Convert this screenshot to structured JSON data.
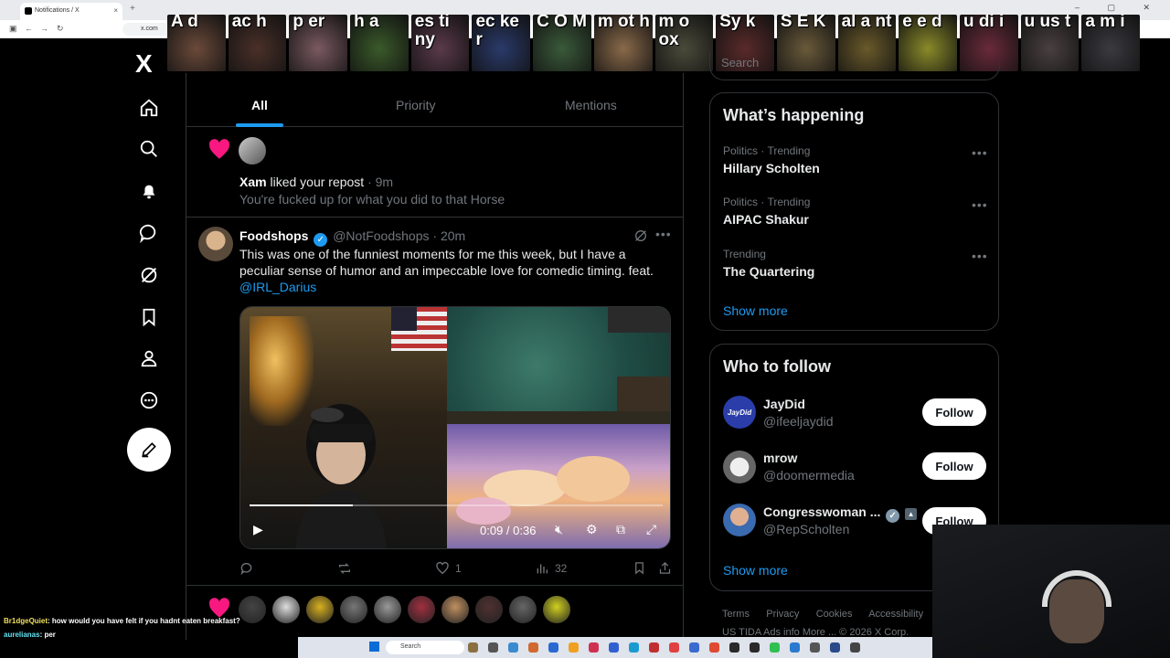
{
  "browser": {
    "tab_title": "Notifications / X",
    "tab_close": "×",
    "new_tab": "+",
    "window_controls": "– ▢ ✕",
    "address": "x.com"
  },
  "stream_overlay": {
    "emote_labels": [
      "A d",
      "ac h",
      "p er",
      "h a",
      "es ti ny",
      "ec ke r",
      "C O M",
      "m ot h",
      "m o ox",
      "Sy k",
      "S E K",
      "al a nt",
      "e e d",
      "u di i",
      "u us t",
      "a m i"
    ]
  },
  "nav": {
    "logo": "X",
    "items": [
      "home",
      "explore",
      "notifications",
      "messages",
      "grok",
      "bookmarks",
      "profile",
      "more"
    ]
  },
  "notifications": {
    "tabs": [
      "All",
      "Priority",
      "Mentions"
    ],
    "active_tab": "All",
    "liked": {
      "user": "Xam",
      "action": "liked your repost",
      "time": "· 9m",
      "text": "You're fucked up for what you did to that Horse"
    }
  },
  "tweet": {
    "name": "Foodshops",
    "handle": "@NotFoodshops",
    "time": "· 20m",
    "text": "This was one of the funniest moments for me this week, but I have a peculiar sense of humor and an impeccable love for comedic timing. feat.",
    "mention": "@IRL_Darius",
    "video": {
      "time": "0:09 / 0:36",
      "progress": 0.25
    },
    "replies": "",
    "reposts": "",
    "likes": "1",
    "views": "32"
  },
  "sidebar": {
    "search_placeholder": "Search",
    "trending_title": "What’s happening",
    "trends": [
      {
        "category": "Politics · Trending",
        "name": "Hillary Scholten"
      },
      {
        "category": "Politics · Trending",
        "name": "AIPAC Shakur"
      },
      {
        "category": "Trending",
        "name": "The Quartering"
      }
    ],
    "show_more": "Show more",
    "follow_title": "Who to follow",
    "follow": [
      {
        "name": "JayDid",
        "handle": "@ifeeljaydid",
        "button": "Follow",
        "avatar_text": "JayDid"
      },
      {
        "name": "mrow",
        "handle": "@doomermedia",
        "button": "Follow"
      },
      {
        "name": "Congresswoman ...",
        "handle": "@RepScholten",
        "button": "Follow"
      }
    ],
    "footer": [
      "Terms",
      "Privacy",
      "Cookies",
      "Accessibility"
    ],
    "footer2": "US TIDA   Ads info   More ...   © 2026 X Corp."
  },
  "chat_overlay": {
    "line1_user": "Br1dgeQuiet",
    "line1_text": ": how would you have felt if you hadnt eaten breakfast?",
    "line2_user": "aurelianas",
    "line2_text": ": per"
  },
  "taskbar": {
    "search_label": "Search"
  },
  "colors": {
    "accent": "#1d9bf0",
    "like": "#f91880"
  }
}
